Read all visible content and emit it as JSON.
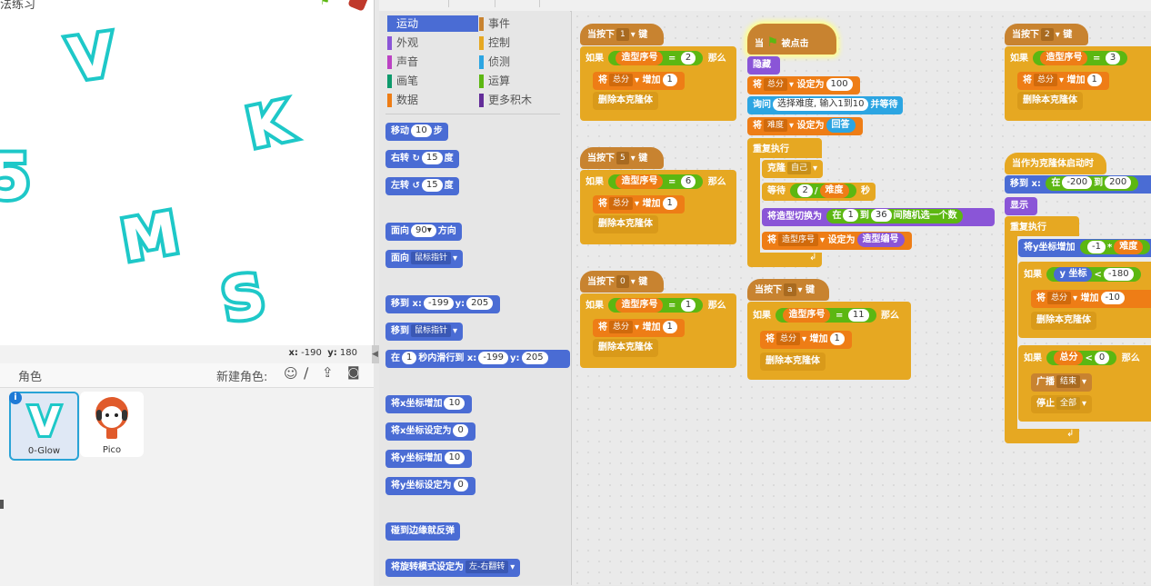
{
  "stage": {
    "title": "法练习",
    "letters": [
      "V",
      "K",
      "5",
      "M",
      "S"
    ],
    "coords": {
      "x_label": "x:",
      "x": "-190",
      "y_label": "y:",
      "y": "180"
    },
    "colors": {
      "letter_outline": "#1ec8c8"
    }
  },
  "sprites": {
    "header": "角色",
    "new_sprite_label": "新建角色:",
    "items": [
      {
        "name": "0-Glow",
        "thumb": "V"
      },
      {
        "name": "Pico",
        "thumb": ""
      }
    ]
  },
  "categories": [
    {
      "label": "运动",
      "color": "#4a6cd4"
    },
    {
      "label": "事件",
      "color": "#c88330"
    },
    {
      "label": "外观",
      "color": "#8a55d7"
    },
    {
      "label": "控制",
      "color": "#e6a822"
    },
    {
      "label": "声音",
      "color": "#bb42c3"
    },
    {
      "label": "侦测",
      "color": "#2ca5e2"
    },
    {
      "label": "画笔",
      "color": "#0e9a6c"
    },
    {
      "label": "运算",
      "color": "#5cb712"
    },
    {
      "label": "数据",
      "color": "#ee7d16"
    },
    {
      "label": "更多积木",
      "color": "#632d99"
    }
  ],
  "palette": {
    "move": {
      "a": "移动",
      "v": "10",
      "b": "步"
    },
    "turn_right": {
      "a": "右转",
      "v": "15",
      "b": "度"
    },
    "turn_left": {
      "a": "左转",
      "v": "15",
      "b": "度"
    },
    "point_dir": {
      "a": "面向",
      "v": "90▾",
      "b": "方向"
    },
    "point_towards": {
      "a": "面向",
      "v": "鼠标指针"
    },
    "goto_xy": {
      "a": "移到",
      "xl": "x:",
      "x": "-199",
      "yl": "y:",
      "y": "205"
    },
    "goto": {
      "a": "移到",
      "v": "鼠标指针"
    },
    "glide": {
      "a": "在",
      "v": "1",
      "b": "秒内滑行到",
      "xl": "x:",
      "x": "-199",
      "yl": "y:",
      "y": "205"
    },
    "change_x": {
      "a": "将x坐标增加",
      "v": "10"
    },
    "set_x": {
      "a": "将x坐标设定为",
      "v": "0"
    },
    "change_y": {
      "a": "将y坐标增加",
      "v": "10"
    },
    "set_y": {
      "a": "将y坐标设定为",
      "v": "0"
    },
    "bounce": {
      "a": "碰到边缘就反弹"
    },
    "rotation_style": {
      "a": "将旋转模式设定为",
      "v": "左-右翻转"
    }
  },
  "scripts": {
    "when_key": "当按下",
    "key_suffix": "键",
    "if": "如果",
    "then": "那么",
    "costume_num": "造型序号",
    "set_to": "将",
    "score": "总分",
    "change_by": "增加",
    "delete_clone": "删除本克隆体",
    "s1": {
      "key": "1",
      "num": "2",
      "inc": "1"
    },
    "s2": {
      "key": "5",
      "num": "6",
      "inc": "1"
    },
    "s3": {
      "key": "0",
      "num": "1",
      "inc": "1"
    },
    "s4": {
      "key": "a",
      "num": "11",
      "inc": "1"
    },
    "s5": {
      "key": "2",
      "num": "3",
      "inc": "1"
    },
    "flag": {
      "when": "当",
      "clicked": "被点击",
      "hide": "隐藏",
      "set_score_a": "将",
      "set_score_v": "总分",
      "set_score_b": "设定为",
      "set_score_n": "100",
      "ask_a": "询问",
      "ask_v": "选择难度, 输入1到10",
      "ask_b": "并等待",
      "set_diff_a": "将",
      "set_diff_v": "难度",
      "set_diff_b": "设定为",
      "answer": "回答",
      "forever": "重复执行",
      "clone": "克隆",
      "clone_v": "自己",
      "wait": "等待",
      "two": "2",
      "div": "/",
      "diff": "难度",
      "sec": "秒",
      "switch": "将造型切换为",
      "rand_a": "在",
      "rand_min": "1",
      "rand_to": "到",
      "rand_max": "36",
      "rand_b": "间随机选一个数",
      "set_costume_a": "将",
      "set_costume_v": "造型序号",
      "set_costume_b": "设定为",
      "costume_id": "造型编号"
    },
    "clone_start": {
      "hat": "当作为克隆体启动时",
      "goto": "移到",
      "xl": "x:",
      "x_a": "在",
      "x_min": "-200",
      "x_to": "到",
      "x_max": "200",
      "show": "显示",
      "forever": "重复执行",
      "change_y": "将y坐标增加",
      "neg1": "-1",
      "mul": "*",
      "diff": "难度",
      "if": "如果",
      "y_pos": "y 坐标",
      "lt": "<",
      "y_lim": "-180",
      "then": "那么",
      "score": "总分",
      "inc": "增加",
      "neg10": "-10",
      "delete_clone": "删除本克隆体",
      "score_lt": "<",
      "zero": "0",
      "broadcast": "广播",
      "end": "结束",
      "stop": "停止",
      "all": "全部"
    }
  }
}
